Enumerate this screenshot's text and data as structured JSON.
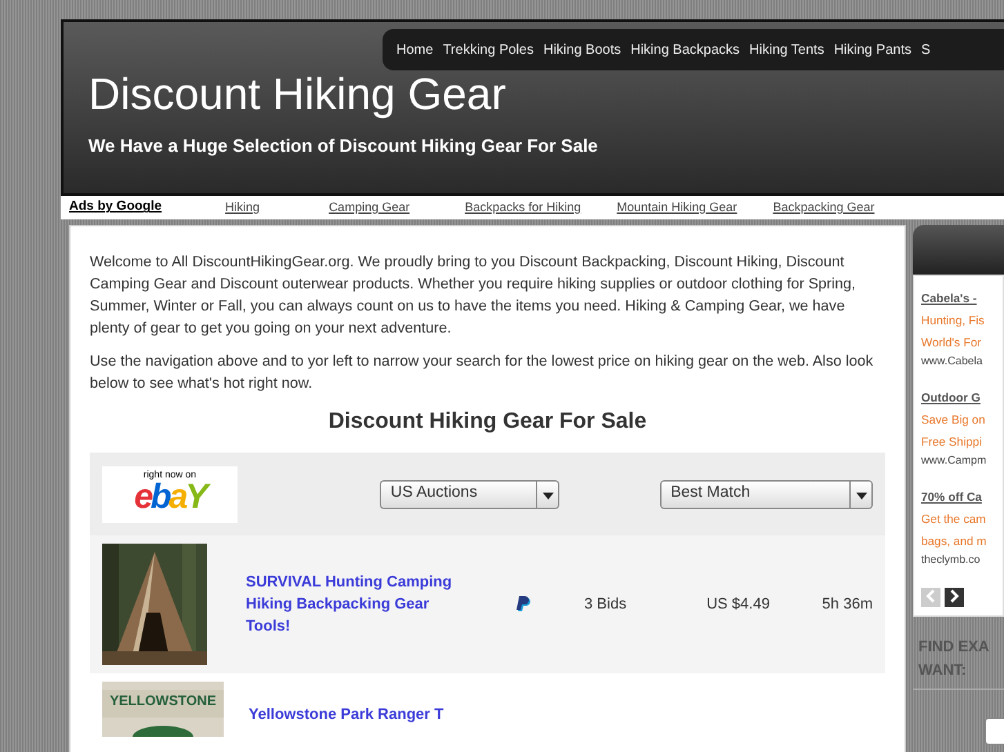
{
  "nav": [
    {
      "label": "Home"
    },
    {
      "label": "Trekking Poles"
    },
    {
      "label": "Hiking Boots"
    },
    {
      "label": "Hiking Backpacks"
    },
    {
      "label": "Hiking Tents"
    },
    {
      "label": "Hiking Pants"
    },
    {
      "label": "S"
    }
  ],
  "site_title": "Discount Hiking Gear",
  "tagline": "We Have a Huge Selection of Discount Hiking Gear For Sale",
  "ads_bar": {
    "label": "Ads by Google",
    "links": [
      "Hiking",
      "Camping Gear",
      "Backpacks for Hiking",
      "Mountain Hiking Gear",
      "Backpacking Gear"
    ]
  },
  "intro": [
    "Welcome to All DiscountHikingGear.org. We proudly bring to you Discount Backpacking, Discount Hiking, Discount Camping Gear and Discount outerwear products. Whether you require hiking supplies or outdoor clothing for Spring, Summer, Winter or Fall, you can always count on us to have the items you need. Hiking & Camping Gear, we have plenty of gear to get you going on your next adventure.",
    "Use the navigation above and to yor left to narrow your search for the lowest price on hiking gear on the web. Also look below to see what's hot right now."
  ],
  "section_heading": "Discount Hiking Gear For Sale",
  "ebay": {
    "caption": "right now on",
    "logo": [
      "e",
      "b",
      "a",
      "Y"
    ],
    "filters": [
      "US Auctions",
      "Best Match"
    ]
  },
  "listings": [
    {
      "title": "SURVIVAL Hunting Camping Hiking Backpacking Gear Tools!",
      "paypal": true,
      "bids": "3 Bids",
      "price": "US $4.49",
      "time_left": "5h 36m",
      "kind": "forest"
    },
    {
      "title": "Yellowstone Park Ranger T",
      "kind": "shirt",
      "shirt_text": "YELLOWSTONE"
    }
  ],
  "sidebar": {
    "ads": [
      {
        "title": "Cabela's -",
        "lines": [
          "Hunting, Fis",
          "World's For"
        ],
        "url": "www.Cabela"
      },
      {
        "title": "Outdoor G",
        "lines": [
          "Save Big on",
          "Free Shippi"
        ],
        "url": "www.Campm"
      },
      {
        "title": "70% off Ca",
        "lines": [
          "Get the cam",
          "bags, and m"
        ],
        "url": "theclymb.co"
      }
    ],
    "find_heading": [
      "FIND EXA",
      "WANT:"
    ]
  }
}
